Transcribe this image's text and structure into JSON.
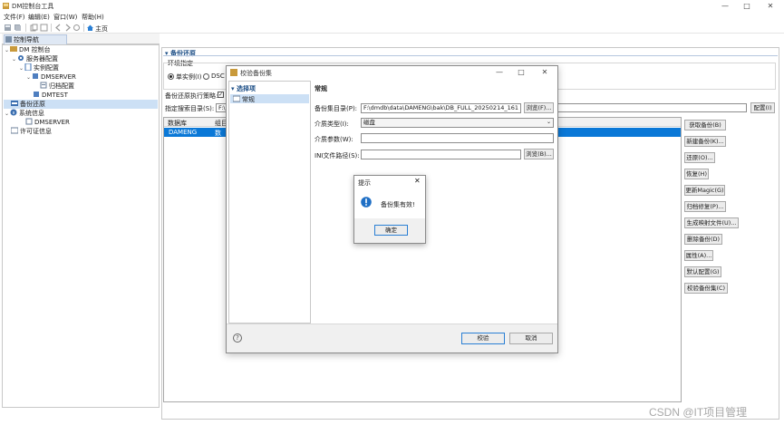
{
  "app": {
    "title": "DM控制台工具"
  },
  "window_controls": {
    "minimize": "—",
    "maximize": "□",
    "close": "✕"
  },
  "menu": [
    "文件(F)",
    "编辑(E)",
    "窗口(W)",
    "帮助(H)"
  ],
  "toolbar": {
    "home_label": "主页"
  },
  "nav": {
    "tab_label": "控制导航",
    "tree": {
      "root": "DM 控制台",
      "server_config": "服务器配置",
      "instance_config": "实例配置",
      "dmserver": "DMSERVER",
      "archive_config": "归档配置",
      "dmtest": "DMTEST",
      "backup_restore": "备份还原",
      "system_info": "系统信息",
      "sys_dmserver": "DMSERVER",
      "license_info": "许可证信息"
    }
  },
  "main": {
    "section_title": "备份还原",
    "env_label": "环境指定",
    "radio_single": "单实例(I)",
    "radio_dsc": "DSC",
    "exec_strategy_label": "备份还原执行策略:",
    "search_dir_label": "指定搜索目录(S):",
    "search_dir_value": "F:\\",
    "config_button": "配置(I)",
    "table": {
      "headers": [
        "数据库",
        "组目"
      ],
      "rows": [
        [
          "DAMENG",
          "数"
        ]
      ]
    },
    "actions": [
      "获取备份(B)",
      "新建备份(K)...",
      "还原(O)...",
      "恢复(H)",
      "更新Magic(G)",
      "归档修复(P)...",
      "生成映射文件(U)...",
      "删除备份(D)",
      "属性(A)...",
      "默认配置(G)",
      "校验备份集(C)"
    ]
  },
  "dialog": {
    "title": "校验备份集",
    "tree_header": "选择项",
    "tree_item": "常规",
    "panel_title": "常规",
    "backup_dir_label": "备份集目录(P):",
    "backup_dir_value": "F:\\dmdb\\data\\DAMENG\\bak\\DB_FULL_20250214_161",
    "browse_label": "浏览(F)...",
    "media_type_label": "介质类型(I):",
    "media_type_value": "磁盘",
    "media_params_label": "介质参数(W):",
    "media_params_value": "",
    "ini_label": "INI文件路径(S):",
    "ini_value": "",
    "browse2_label": "浏览(B)...",
    "help_icon": "?",
    "verify_button": "校验",
    "cancel_button": "取消"
  },
  "message": {
    "title": "提示",
    "text": "备份集有效!",
    "ok": "确定"
  },
  "watermark": "CSDN @IT项目管理"
}
